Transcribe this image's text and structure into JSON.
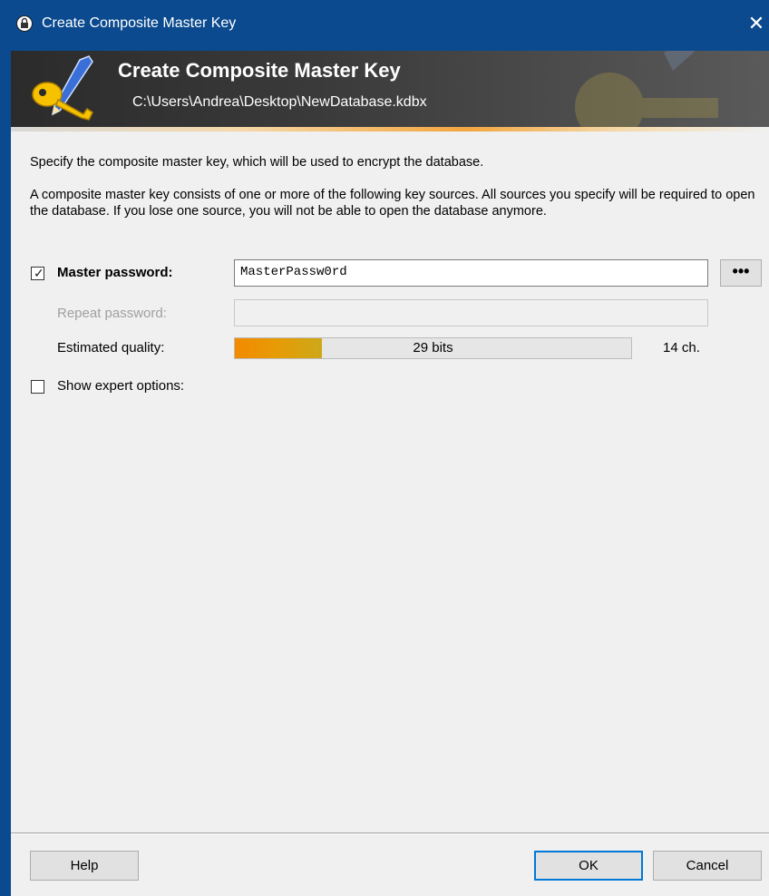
{
  "window": {
    "title": "Create Composite Master Key",
    "close_glyph": "✕"
  },
  "banner": {
    "title": "Create Composite Master Key",
    "path": "C:\\Users\\Andrea\\Desktop\\NewDatabase.kdbx",
    "icon": "key-pencil-icon"
  },
  "intro": {
    "line1": "Specify the composite master key, which will be used to encrypt the database.",
    "line2": "A composite master key consists of one or more of the following key sources. All sources you specify will be required to open the database. If you lose one source, you will not be able to open the database anymore."
  },
  "master_password": {
    "checked": true,
    "label": "Master password:",
    "value": "MasterPassw0rd",
    "reveal_button": "•••"
  },
  "repeat_password": {
    "label": "Repeat password:",
    "value": ""
  },
  "quality": {
    "label": "Estimated quality:",
    "bits_text": "29 bits",
    "fill_fraction": 0.22,
    "char_count": "14 ch."
  },
  "expert": {
    "checked": false,
    "label": "Show expert options:"
  },
  "buttons": {
    "help": "Help",
    "ok": "OK",
    "cancel": "Cancel"
  },
  "colors": {
    "accent": "#0078d7",
    "titlebar": "#0b4a8e",
    "quality_fill": "#f28a00"
  }
}
